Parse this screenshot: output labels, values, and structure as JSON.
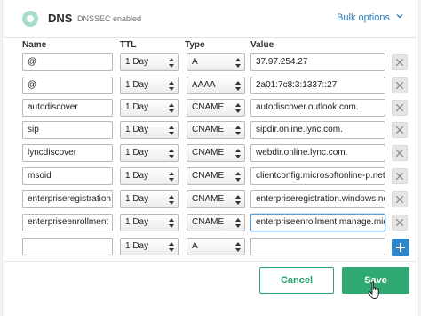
{
  "header": {
    "title": "DNS",
    "dnssec_status": "DNSSEC enabled",
    "bulk_options_label": "Bulk options"
  },
  "columns": {
    "name": "Name",
    "ttl": "TTL",
    "type": "Type",
    "value": "Value"
  },
  "records": [
    {
      "name": "@",
      "ttl": "1 Day",
      "type": "A",
      "value": "37.97.254.27"
    },
    {
      "name": "@",
      "ttl": "1 Day",
      "type": "AAAA",
      "value": "2a01:7c8:3:1337::27"
    },
    {
      "name": "autodiscover",
      "ttl": "1 Day",
      "type": "CNAME",
      "value": "autodiscover.outlook.com."
    },
    {
      "name": "sip",
      "ttl": "1 Day",
      "type": "CNAME",
      "value": "sipdir.online.lync.com."
    },
    {
      "name": "lyncdiscover",
      "ttl": "1 Day",
      "type": "CNAME",
      "value": "webdir.online.lync.com."
    },
    {
      "name": "msoid",
      "ttl": "1 Day",
      "type": "CNAME",
      "value": "clientconfig.microsoftonline-p.net."
    },
    {
      "name": "enterpriseregistration",
      "ttl": "1 Day",
      "type": "CNAME",
      "value": "enterpriseregistration.windows.net."
    },
    {
      "name": "enterpriseenrollment",
      "ttl": "1 Day",
      "type": "CNAME",
      "value": "enterpriseenrollment.manage.micros"
    }
  ],
  "new_record": {
    "name": "",
    "ttl": "1 Day",
    "type": "A",
    "value": ""
  },
  "actions": {
    "cancel_label": "Cancel",
    "save_label": "Save"
  },
  "colors": {
    "accent_green": "#2fa872",
    "link_blue": "#2e7fbd",
    "add_button_blue": "#2d86c9"
  },
  "icons": {
    "logo": "transip-logo-icon",
    "bulk": "chevron-down-icon",
    "delete": "close-icon",
    "add": "plus-icon",
    "select_arrows": "updown-arrows-icon",
    "cursor": "hand-pointer-icon"
  }
}
